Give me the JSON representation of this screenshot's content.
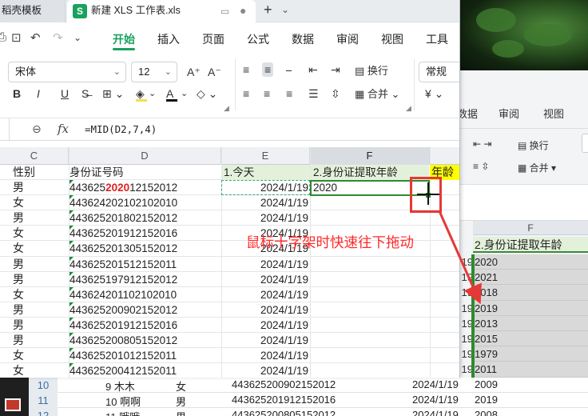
{
  "back_window": {
    "ribbon_tabs": [
      "数据",
      "审阅",
      "视图"
    ],
    "toolbar": {
      "wrap_label": "换行",
      "merge_label": "合并"
    },
    "column_letter": "F",
    "header_text": "2.身份证提取年龄",
    "years": [
      "2020",
      "2021",
      "2018",
      "2019",
      "2013",
      "2015",
      "1979",
      "2011",
      "2009",
      "2019",
      "2008"
    ],
    "left_partial": [
      "19",
      "19",
      "19",
      "19",
      "19",
      "19",
      "19",
      "19"
    ],
    "bottom_rows": [
      {
        "num": "10",
        "name": "9 木木",
        "sex": "女",
        "id": "443625200902152012",
        "date": "2024/1/19"
      },
      {
        "num": "11",
        "name": "10 啊啊",
        "sex": "男",
        "id": "443625201912152016",
        "date": "2024/1/19"
      },
      {
        "num": "12",
        "name": "11 哦哦",
        "sex": "男",
        "id": "443625200805152012",
        "date": "2024/1/19"
      }
    ]
  },
  "tabs": {
    "inactive_label": "稻壳模板",
    "active_label": "新建 XLS 工作表.xls",
    "logo": "S",
    "new_tab": "+"
  },
  "menu": {
    "items": [
      "开始",
      "插入",
      "页面",
      "公式",
      "数据",
      "审阅",
      "视图",
      "工具"
    ],
    "active": "开始"
  },
  "ribbon": {
    "font_name": "宋体",
    "font_size": "12",
    "wrap_label": "换行",
    "merge_label": "合并",
    "number_format": "常规",
    "grow_font": "A⁺",
    "shrink_font": "A⁻",
    "bold": "B",
    "italic": "I",
    "underline": "U",
    "currency": "¥"
  },
  "formula_bar": {
    "formula": "=MID(D2,7,4)",
    "fx": "fx"
  },
  "columns": [
    "C",
    "D",
    "E",
    "F"
  ],
  "header_row": {
    "c": "性别",
    "d": "身份证号码",
    "e": "1.今天",
    "f": "2.身份证提取年龄",
    "g": "年龄"
  },
  "rows": [
    {
      "sex": "男",
      "id_pre": "443625",
      "id_mid": "2020",
      "id_post": "12152012",
      "date": "2024/1/19",
      "f": "2020"
    },
    {
      "sex": "女",
      "id_pre": "4436242021",
      "id_mid": "",
      "id_post": "02102010",
      "date": "2024/1/19",
      "f": ""
    },
    {
      "sex": "男",
      "id_pre": "4436252018",
      "id_mid": "",
      "id_post": "02152012",
      "date": "2024/1/19",
      "f": ""
    },
    {
      "sex": "女",
      "id_pre": "4436252019",
      "id_mid": "",
      "id_post": "12152016",
      "date": "2024/1/19",
      "f": ""
    },
    {
      "sex": "女",
      "id_pre": "4436252013",
      "id_mid": "",
      "id_post": "05152012",
      "date": "2024/1/19",
      "f": ""
    },
    {
      "sex": "男",
      "id_pre": "4436252015",
      "id_mid": "",
      "id_post": "12152011",
      "date": "2024/1/19",
      "f": ""
    },
    {
      "sex": "男",
      "id_pre": "4436251979",
      "id_mid": "",
      "id_post": "12152012",
      "date": "2024/1/19",
      "f": ""
    },
    {
      "sex": "女",
      "id_pre": "4436242011",
      "id_mid": "",
      "id_post": "02102010",
      "date": "2024/1/19",
      "f": ""
    },
    {
      "sex": "男",
      "id_pre": "4436252009",
      "id_mid": "",
      "id_post": "02152012",
      "date": "2024/1/19",
      "f": ""
    },
    {
      "sex": "男",
      "id_pre": "4436252019",
      "id_mid": "",
      "id_post": "12152016",
      "date": "2024/1/19",
      "f": ""
    },
    {
      "sex": "男",
      "id_pre": "4436252008",
      "id_mid": "",
      "id_post": "05152012",
      "date": "2024/1/19",
      "f": ""
    },
    {
      "sex": "女",
      "id_pre": "4436252010",
      "id_mid": "",
      "id_post": "12152011",
      "date": "2024/1/19",
      "f": ""
    },
    {
      "sex": "女",
      "id_pre": "4436252004",
      "id_mid": "",
      "id_post": "12152011",
      "date": "2024/1/19",
      "f": ""
    }
  ],
  "annotation": "鼠标十字架时快速往下拖动",
  "colors": {
    "accent": "#1aa15f",
    "annotation": "#ff2a2a",
    "selection": "#2e8b2e",
    "header_fill": "#e4f1da",
    "age_header_fill": "#ffff00"
  }
}
